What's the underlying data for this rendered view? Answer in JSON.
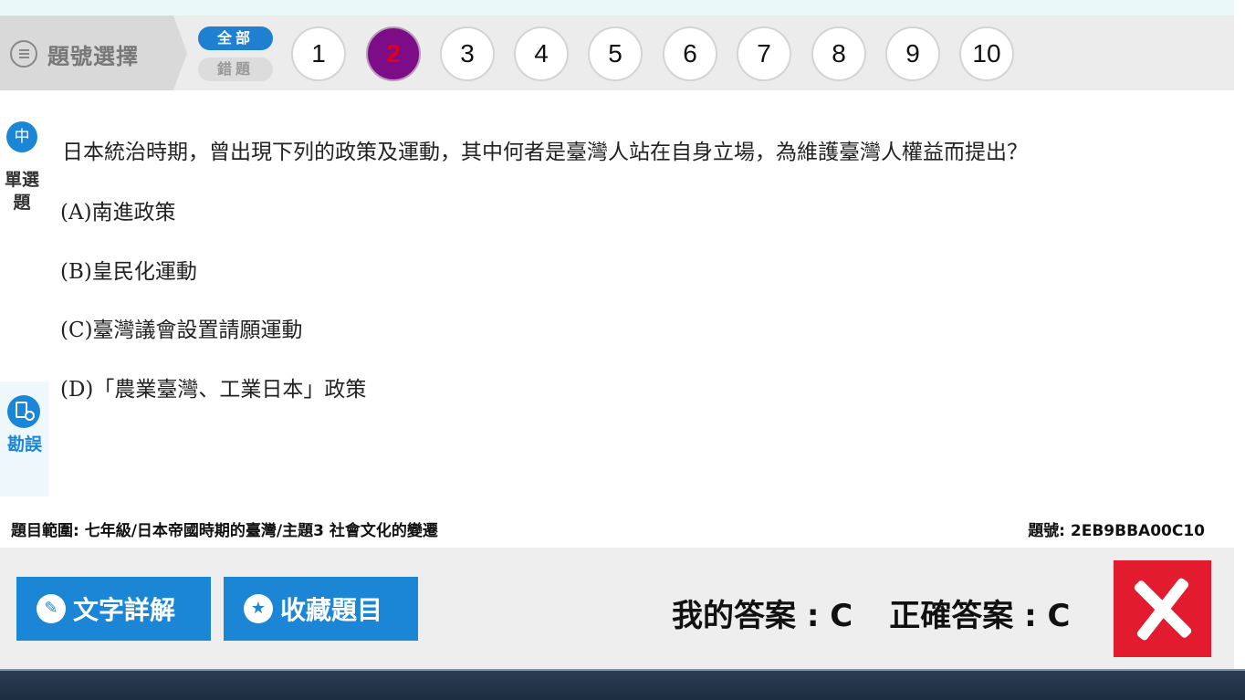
{
  "nav": {
    "select_label": "題號選擇",
    "filter_all": "全部",
    "filter_wrong": "錯題",
    "numbers": [
      "1",
      "2",
      "3",
      "4",
      "5",
      "6",
      "7",
      "8",
      "9",
      "10"
    ],
    "current": "2"
  },
  "side": {
    "lang_icon": "中",
    "type_label": "單選題",
    "report_label": "勘誤"
  },
  "question": {
    "stem": "日本統治時期，曾出現下列的政策及運動，其中何者是臺灣人站在自身立場，為維護臺灣人權益而提出？",
    "options": [
      "(A)南進政策",
      "(B)皇民化運動",
      "(C)臺灣議會設置請願運動",
      "(D)「農業臺灣、工業日本」政策"
    ]
  },
  "meta": {
    "range": "題目範圍: 七年級/日本帝國時期的臺灣/主題3 社會文化的變遷",
    "qid": "題號: 2EB9BBA00C10"
  },
  "actions": {
    "explain_label": "文字詳解",
    "favorite_label": "收藏題目",
    "my_answer": "我的答案 : C",
    "correct_answer": "正確答案 : C",
    "result_icon": "wrong-icon"
  },
  "colors": {
    "accent": "#1b86d6",
    "current_question": "#7c0d86",
    "wrong": "#e31b2e"
  }
}
